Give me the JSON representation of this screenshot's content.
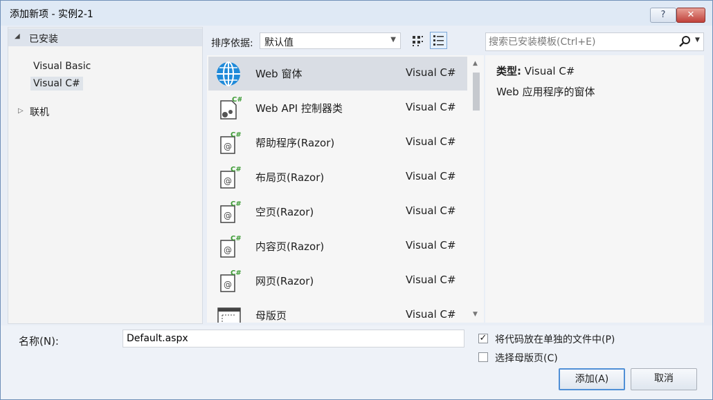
{
  "window": {
    "title": "添加新项 - 实例2-1",
    "help_label": "?",
    "close_label": "✕"
  },
  "tree": {
    "installed_label": "已安装",
    "children": [
      "Visual Basic",
      "Visual C#"
    ],
    "online_label": "联机"
  },
  "sort": {
    "label": "排序依据:",
    "value": "默认值"
  },
  "search": {
    "placeholder": "搜索已安装模板(Ctrl+E)"
  },
  "templates": [
    {
      "name": "Web 窗体",
      "lang": "Visual C#",
      "icon": "globe-icon"
    },
    {
      "name": "Web API 控制器类",
      "lang": "Visual C#",
      "icon": "controller-class-icon"
    },
    {
      "name": "帮助程序(Razor)",
      "lang": "Visual C#",
      "icon": "razor-page-icon"
    },
    {
      "name": "布局页(Razor)",
      "lang": "Visual C#",
      "icon": "razor-page-icon"
    },
    {
      "name": "空页(Razor)",
      "lang": "Visual C#",
      "icon": "razor-page-icon"
    },
    {
      "name": "内容页(Razor)",
      "lang": "Visual C#",
      "icon": "razor-page-icon"
    },
    {
      "name": "网页(Razor)",
      "lang": "Visual C#",
      "icon": "razor-page-icon"
    },
    {
      "name": "母版页",
      "lang": "Visual C#",
      "icon": "master-page-icon"
    }
  ],
  "details": {
    "type_label": "类型:",
    "type_value": "Visual C#",
    "description": "Web 应用程序的窗体"
  },
  "bottom": {
    "name_label": "名称(N):",
    "name_value": "Default.aspx",
    "code_separate_label": "将代码放在单独的文件中(P)",
    "code_separate_checked": true,
    "master_label": "选择母版页(C)",
    "master_checked": false,
    "add_label": "添加(A)",
    "cancel_label": "取消"
  },
  "colors": {
    "accent": "#4f8fd6",
    "selection": "#d9dde4",
    "close": "#c0413a"
  }
}
